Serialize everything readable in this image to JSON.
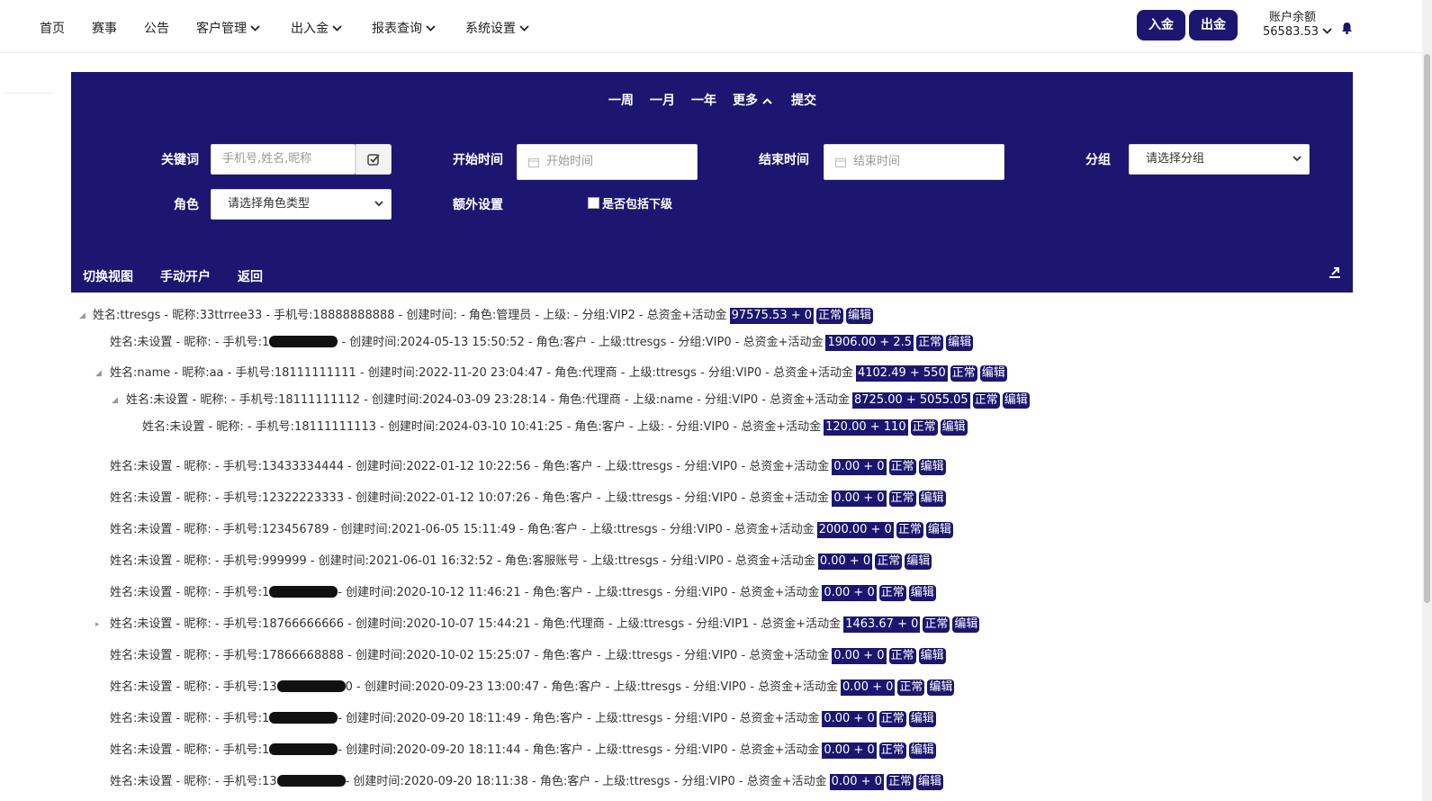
{
  "nav": {
    "items": [
      {
        "label": "首页",
        "has_dropdown": false
      },
      {
        "label": "赛事",
        "has_dropdown": false
      },
      {
        "label": "公告",
        "has_dropdown": false
      },
      {
        "label": "客户管理",
        "has_dropdown": true
      },
      {
        "label": "出入金",
        "has_dropdown": true
      },
      {
        "label": "报表查询",
        "has_dropdown": true
      },
      {
        "label": "系统设置",
        "has_dropdown": true
      }
    ],
    "deposit_label": "入金",
    "withdraw_label": "出金",
    "balance_label": "账户余额",
    "balance_value": "56583.53",
    "accent_color": "#1c1670"
  },
  "filters": {
    "quick_ranges": [
      "一周",
      "一月",
      "一年",
      "更多",
      "提交"
    ],
    "keyword_label": "关键词",
    "keyword_placeholder": "手机号,姓名,昵称",
    "start_label": "开始时间",
    "start_placeholder": "开始时间",
    "end_label": "结束时间",
    "end_placeholder": "结束时间",
    "group_label": "分组",
    "group_value": "请选择分组",
    "role_label": "角色",
    "role_value": "请选择角色类型",
    "extra_label": "额外设置",
    "include_sub_label": "是否包括下级"
  },
  "toolbar": {
    "switch_view": "切换视图",
    "manual_open": "手动开户",
    "back": "返回"
  },
  "tree": [
    {
      "text": "姓名:ttresgs - 昵称:33ttrree33 - 手机号:18888888888 - 创建时间: - 角色:管理员 - 上级: - 分组:VIP2 - 总资金+活动金",
      "money": "97575.53 + 0",
      "status": "正常",
      "edit": "编辑",
      "toggle": "expanded"
    },
    {
      "text_pre": "姓名:未设置 - 昵称: - 手机号:1",
      "text_post": " - 创建时间:2024-05-13 15:50:52 - 角色:客户 - 上级:ttresgs - 分组:VIP0 - 总资金+活动金",
      "money": "1906.00 + 2.5",
      "status": "正常",
      "edit": "编辑",
      "toggle": "none"
    },
    {
      "text": "姓名:name - 昵称:aa - 手机号:18111111111 - 创建时间:2022-11-20 23:04:47 - 角色:代理商 - 上级:ttresgs - 分组:VIP0 - 总资金+活动金",
      "money": "4102.49 + 550",
      "status": "正常",
      "edit": "编辑",
      "toggle": "expanded"
    },
    {
      "text": "姓名:未设置 - 昵称: - 手机号:18111111112 - 创建时间:2024-03-09 23:28:14 - 角色:代理商 - 上级:name - 分组:VIP0 - 总资金+活动金",
      "money": "8725.00 + 5055.05",
      "status": "正常",
      "edit": "编辑",
      "toggle": "expanded"
    },
    {
      "text": "姓名:未设置 - 昵称: - 手机号:18111111113 - 创建时间:2024-03-10 10:41:25 - 角色:客户 - 上级: - 分组:VIP0 - 总资金+活动金",
      "money": "120.00 + 110",
      "status": "正常",
      "edit": "编辑",
      "toggle": "none"
    },
    {
      "text": "姓名:未设置 - 昵称: - 手机号:13433334444 - 创建时间:2022-01-12 10:22:56 - 角色:客户 - 上级:ttresgs - 分组:VIP0 - 总资金+活动金",
      "money": "0.00 + 0",
      "status": "正常",
      "edit": "编辑",
      "toggle": "none"
    },
    {
      "text": "姓名:未设置 - 昵称: - 手机号:12322223333 - 创建时间:2022-01-12 10:07:26 - 角色:客户 - 上级:ttresgs - 分组:VIP0 - 总资金+活动金",
      "money": "0.00 + 0",
      "status": "正常",
      "edit": "编辑",
      "toggle": "none"
    },
    {
      "text": "姓名:未设置 - 昵称: - 手机号:123456789 - 创建时间:2021-06-05 15:11:49 - 角色:客户 - 上级:ttresgs - 分组:VIP0 - 总资金+活动金",
      "money": "2000.00 + 0",
      "status": "正常",
      "edit": "编辑",
      "toggle": "none"
    },
    {
      "text": "姓名:未设置 - 昵称: - 手机号:999999 - 创建时间:2021-06-01 16:32:52 - 角色:客服账号 - 上级:ttresgs - 分组:VIP0 - 总资金+活动金",
      "money": "0.00 + 0",
      "status": "正常",
      "edit": "编辑",
      "toggle": "none"
    },
    {
      "text_pre": "姓名:未设置 - 昵称: - 手机号:1",
      "text_post": "- 创建时间:2020-10-12 11:46:21 - 角色:客户 - 上级:ttresgs - 分组:VIP0 - 总资金+活动金",
      "money": "0.00 + 0",
      "status": "正常",
      "edit": "编辑",
      "toggle": "none"
    },
    {
      "text": "姓名:未设置 - 昵称: - 手机号:18766666666 - 创建时间:2020-10-07 15:44:21 - 角色:代理商 - 上级:ttresgs - 分组:VIP1 - 总资金+活动金",
      "money": "1463.67 + 0",
      "status": "正常",
      "edit": "编辑",
      "toggle": "collapsed"
    },
    {
      "text": "姓名:未设置 - 昵称: - 手机号:17866668888 - 创建时间:2020-10-02 15:25:07 - 角色:客户 - 上级:ttresgs - 分组:VIP0 - 总资金+活动金",
      "money": "0.00 + 0",
      "status": "正常",
      "edit": "编辑",
      "toggle": "none"
    },
    {
      "text_pre": "姓名:未设置 - 昵称: - 手机号:13",
      "text_post": "0 - 创建时间:2020-09-23 13:00:47 - 角色:客户 - 上级:ttresgs - 分组:VIP0 - 总资金+活动金",
      "money": "0.00 + 0",
      "status": "正常",
      "edit": "编辑",
      "toggle": "none"
    },
    {
      "text_pre": "姓名:未设置 - 昵称: - 手机号:1",
      "text_post": "- 创建时间:2020-09-20 18:11:49 - 角色:客户 - 上级:ttresgs - 分组:VIP0 - 总资金+活动金",
      "money": "0.00 + 0",
      "status": "正常",
      "edit": "编辑",
      "toggle": "none"
    },
    {
      "text_pre": "姓名:未设置 - 昵称: - 手机号:1",
      "text_post": "- 创建时间:2020-09-20 18:11:44 - 角色:客户 - 上级:ttresgs - 分组:VIP0 - 总资金+活动金",
      "money": "0.00 + 0",
      "status": "正常",
      "edit": "编辑",
      "toggle": "none"
    },
    {
      "text_pre": "姓名:未设置 - 昵称: - 手机号:13",
      "text_post": "- 创建时间:2020-09-20 18:11:38 - 角色:客户 - 上级:ttresgs - 分组:VIP0 - 总资金+活动金",
      "money": "0.00 + 0",
      "status": "正常",
      "edit": "编辑",
      "toggle": "none"
    }
  ]
}
